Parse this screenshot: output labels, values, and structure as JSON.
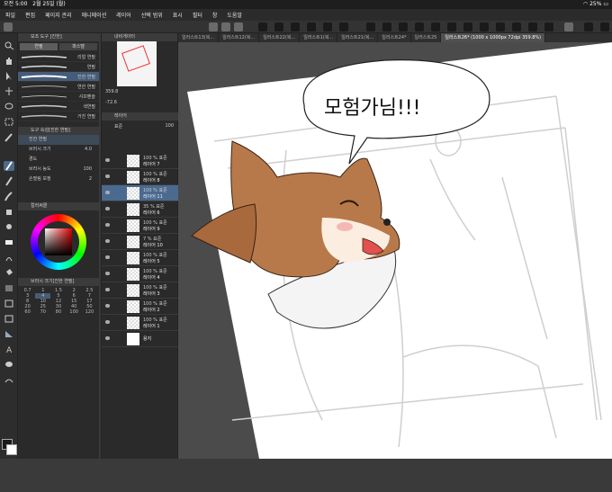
{
  "status": {
    "time": "오전 5:00",
    "date": "2월 25일 (월)",
    "battery": "25%"
  },
  "menu": [
    "파일",
    "편집",
    "페이지 관리",
    "애니메이션",
    "레이어",
    "선택 범위",
    "표시",
    "필터",
    "창",
    "도움말"
  ],
  "tabs": [
    {
      "label": "일러스트13(복..."
    },
    {
      "label": "일러스트12(복..."
    },
    {
      "label": "일러스트22(복..."
    },
    {
      "label": "일러스트1(복..."
    },
    {
      "label": "일러스트21(복..."
    },
    {
      "label": "일러스트24*"
    },
    {
      "label": "일러스트25"
    },
    {
      "label": "일러스트26* (1000 x 1000px 72dpi 359.8%)"
    }
  ],
  "subtool": {
    "header": "보조 도구 [진한]",
    "tabs": [
      "연필",
      "파스텔"
    ],
    "brushes": [
      "리얼 연필",
      "연필",
      "진한 연필",
      "연한 연필",
      "샤프펜슬",
      "색연필",
      "거친 연필"
    ],
    "tool_property_header": "도구 속성[진한 연필]",
    "tool_name": "진한 연필",
    "brush_size_label": "브러시 크기",
    "brush_size_value": "4.0",
    "hardness_label": "경도",
    "density_label": "브러시 농도",
    "density_value": "100",
    "stabilization_label": "손떨림 보정",
    "stabilization_value": "2",
    "color_wheel_header": "컬러써클",
    "brush_size_header": "브러시 크기[진한 연필]",
    "sizes_row1": [
      "0.7",
      "1",
      "1.5",
      "2",
      "2.5"
    ],
    "sizes_row2": [
      "3",
      "4",
      "5",
      "6",
      "7"
    ],
    "sizes_row3": [
      "8",
      "10",
      "12",
      "15",
      "17"
    ],
    "sizes_row4": [
      "20",
      "25",
      "30",
      "40",
      "50"
    ],
    "sizes_row5": [
      "60",
      "70",
      "80",
      "100",
      "120"
    ]
  },
  "navigator": {
    "header": "내비게이터",
    "zoom": "359.8",
    "angle": "-72.6",
    "layer_header": "레이어",
    "blend_mode": "표준",
    "opacity": "100"
  },
  "layers": [
    {
      "pct": "100 % 표준",
      "name": "레이어 7"
    },
    {
      "pct": "100 % 표준",
      "name": "레이어 8"
    },
    {
      "pct": "100 % 표준",
      "name": "레이어 11",
      "active": true
    },
    {
      "pct": "35 % 표준",
      "name": "레이어 6"
    },
    {
      "pct": "100 % 표준",
      "name": "레이어 9"
    },
    {
      "pct": "7 % 표준",
      "name": "레이어 10"
    },
    {
      "pct": "100 % 표준",
      "name": "레이어 5"
    },
    {
      "pct": "100 % 표준",
      "name": "레이어 4"
    },
    {
      "pct": "100 % 표준",
      "name": "레이어 3"
    },
    {
      "pct": "100 % 표준",
      "name": "레이어 2"
    },
    {
      "pct": "100 % 표준",
      "name": "레이어 1"
    },
    {
      "pct": "",
      "name": "용지"
    }
  ],
  "canvas": {
    "speech_text": "모험가님!!!"
  }
}
